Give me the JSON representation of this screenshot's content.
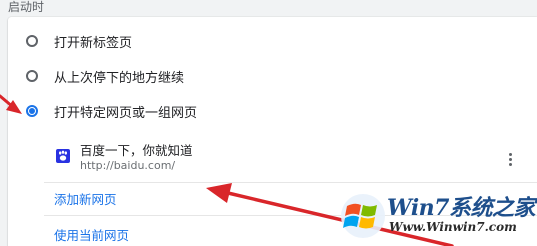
{
  "section": {
    "title": "启动时"
  },
  "startup_options": [
    {
      "label": "打开新标签页",
      "checked": false
    },
    {
      "label": "从上次停下的地方继续",
      "checked": false
    },
    {
      "label": "打开特定网页或一组网页",
      "checked": true
    }
  ],
  "site": {
    "title": "百度一下，你就知道",
    "url": "http://baidu.com/",
    "favicon": "baidu-paw-icon"
  },
  "links": {
    "add_page": "添加新网页",
    "use_current": "使用当前网页"
  },
  "watermark": {
    "brand": "Win7系统之家",
    "url": "Www.Winwin7.com"
  },
  "colors": {
    "accent": "#1a73e8",
    "arrow": "#d9262a",
    "baidu_blue": "#2932e1"
  }
}
